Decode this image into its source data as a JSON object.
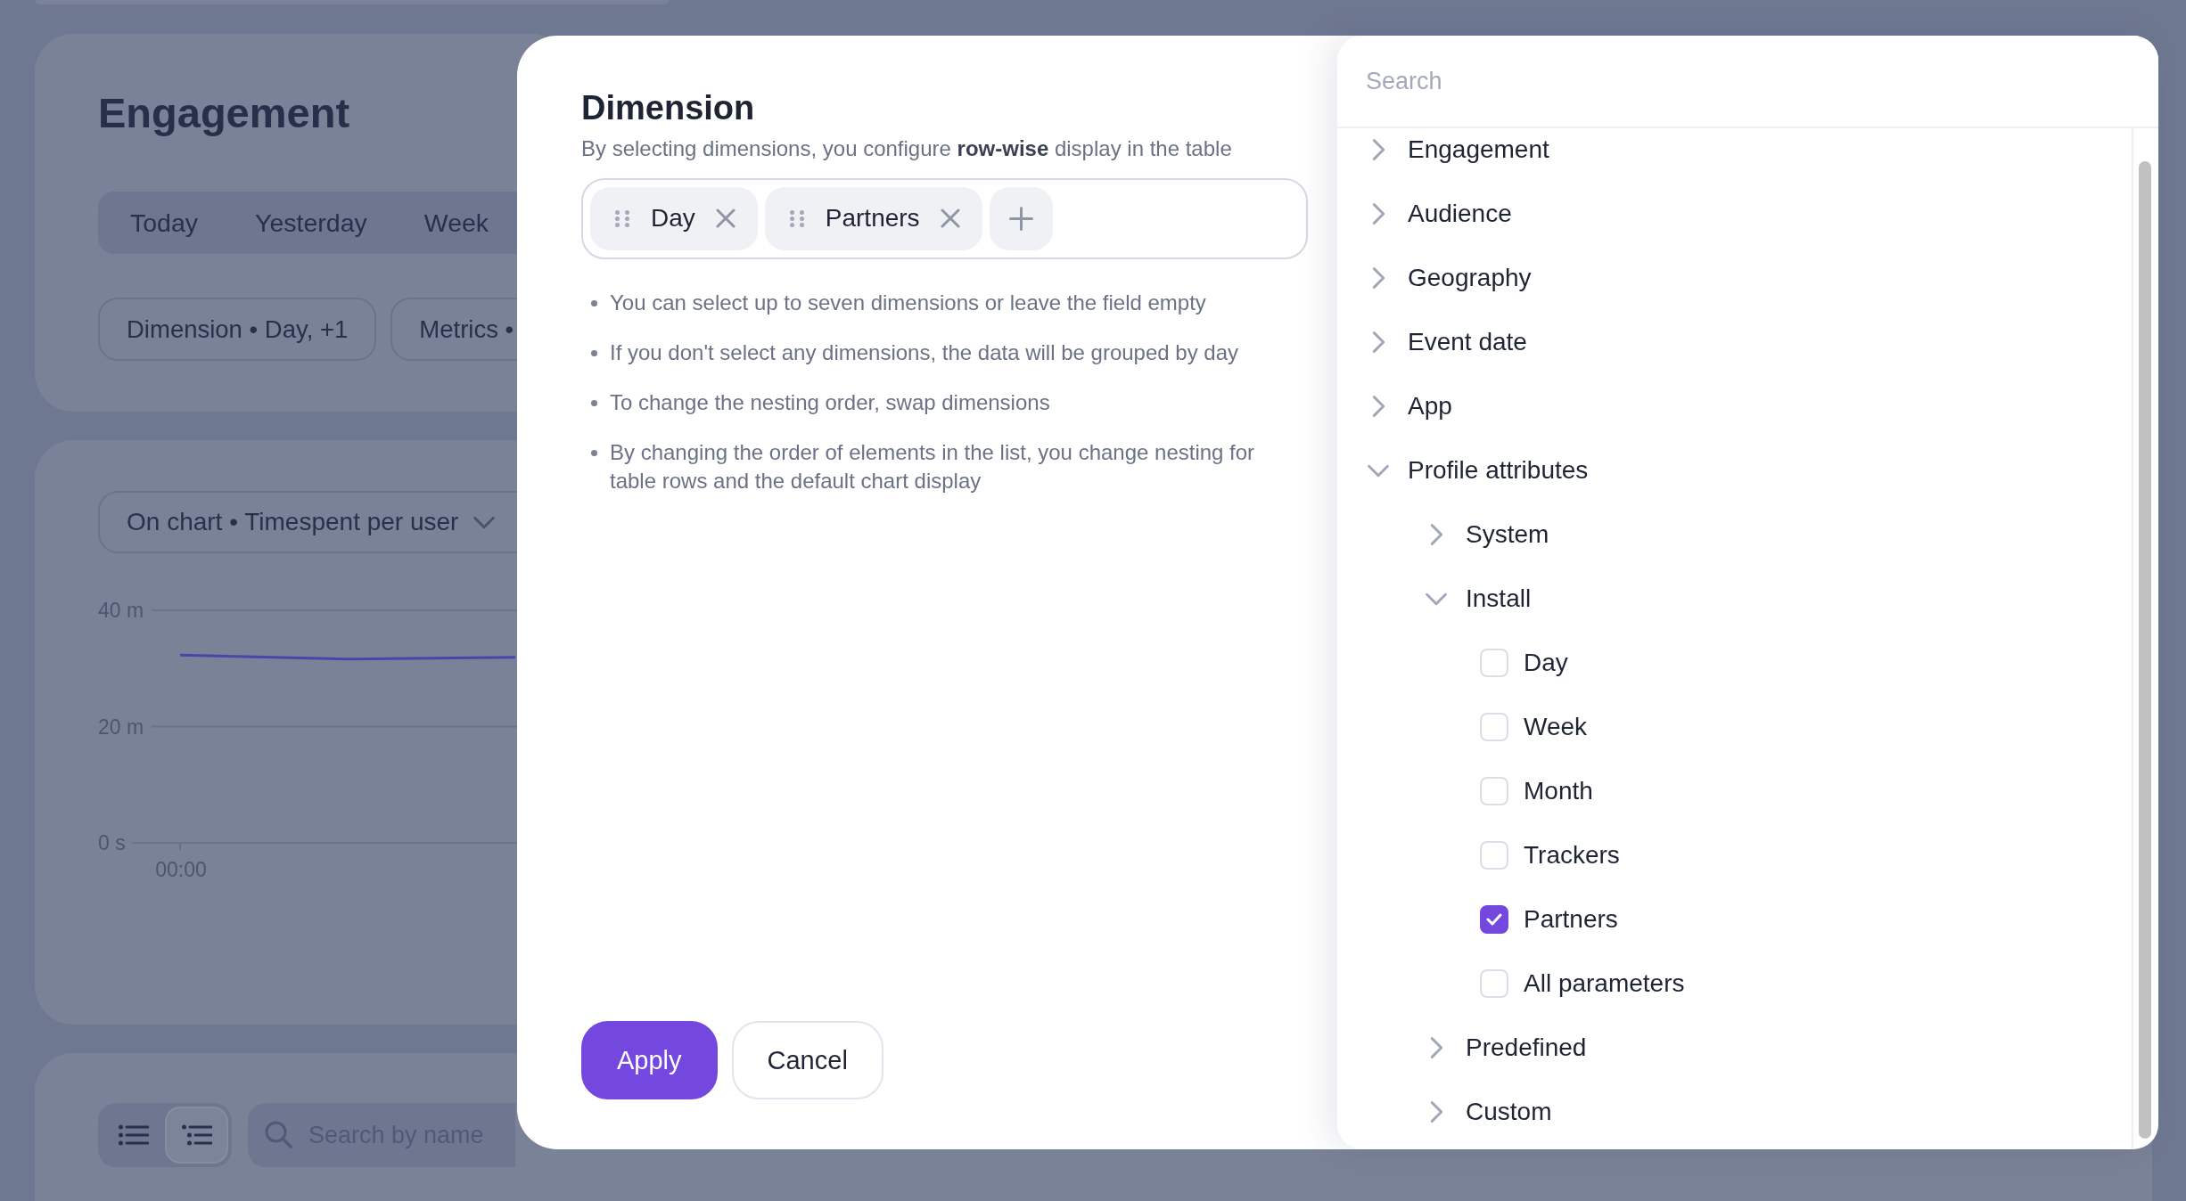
{
  "page": {
    "title": "Engagement",
    "periods": [
      {
        "label": "Today",
        "selected": false
      },
      {
        "label": "Yesterday",
        "selected": false
      },
      {
        "label": "Week",
        "selected": false
      }
    ],
    "filters": [
      "Dimension • Day, +1",
      "Metrics •"
    ]
  },
  "chart_card": {
    "selector": "On chart • Timespent per user",
    "chart_data": [
      {
        "type": "line",
        "categories": [
          "00:00",
          null,
          null
        ],
        "values": [
          32.3,
          31.6,
          31.9
        ],
        "color": "#4c44a8",
        "ylim": [
          0,
          40
        ],
        "yticks": [
          {
            "value": 0,
            "label": "0 s"
          },
          {
            "value": 20,
            "label": "20 m"
          },
          {
            "value": 40,
            "label": "40 m"
          }
        ],
        "grid": true
      }
    ]
  },
  "table_card": {
    "views": [
      {
        "selected": false
      },
      {
        "selected": true
      }
    ],
    "search": {
      "placeholder": "Search by name"
    }
  },
  "dialog": {
    "title": "Dimension",
    "subtitle": "By selecting dimensions, you configure **row-wise** display in the table",
    "chips": [
      "Day",
      "Partners"
    ],
    "notes": [
      "You can select up to seven dimensions or leave the field empty",
      "If you don't select any dimensions, the data will be grouped by day",
      "To change the nesting order, swap dimensions",
      "By changing the order of elements in the list, you change nesting for table rows and the default chart display"
    ],
    "buttons": [
      {
        "label": "Apply",
        "kind": "primary"
      },
      {
        "label": "Cancel",
        "kind": "secondary"
      }
    ]
  },
  "picker": {
    "search": {
      "placeholder": "Search"
    },
    "tree": [
      {
        "kind": "group",
        "label": "Engagement",
        "expanded": false
      },
      {
        "kind": "group",
        "label": "Audience",
        "expanded": false
      },
      {
        "kind": "group",
        "label": "Geography",
        "expanded": false
      },
      {
        "kind": "group",
        "label": "Event date",
        "expanded": false
      },
      {
        "kind": "group",
        "label": "App",
        "expanded": false
      },
      {
        "kind": "group",
        "label": "Profile attributes",
        "expanded": true,
        "children": [
          {
            "kind": "group",
            "label": "System",
            "expanded": false
          },
          {
            "kind": "group",
            "label": "Install",
            "expanded": true,
            "children": [
              {
                "kind": "option",
                "label": "Day",
                "checked": false
              },
              {
                "kind": "option",
                "label": "Week",
                "checked": false
              },
              {
                "kind": "option",
                "label": "Month",
                "checked": false
              },
              {
                "kind": "option",
                "label": "Trackers",
                "checked": false
              },
              {
                "kind": "option",
                "label": "Partners",
                "checked": true
              },
              {
                "kind": "option",
                "label": "All parameters",
                "checked": false
              }
            ]
          },
          {
            "kind": "group",
            "label": "Predefined",
            "expanded": false
          },
          {
            "kind": "group",
            "label": "Custom",
            "expanded": false
          }
        ]
      }
    ]
  }
}
